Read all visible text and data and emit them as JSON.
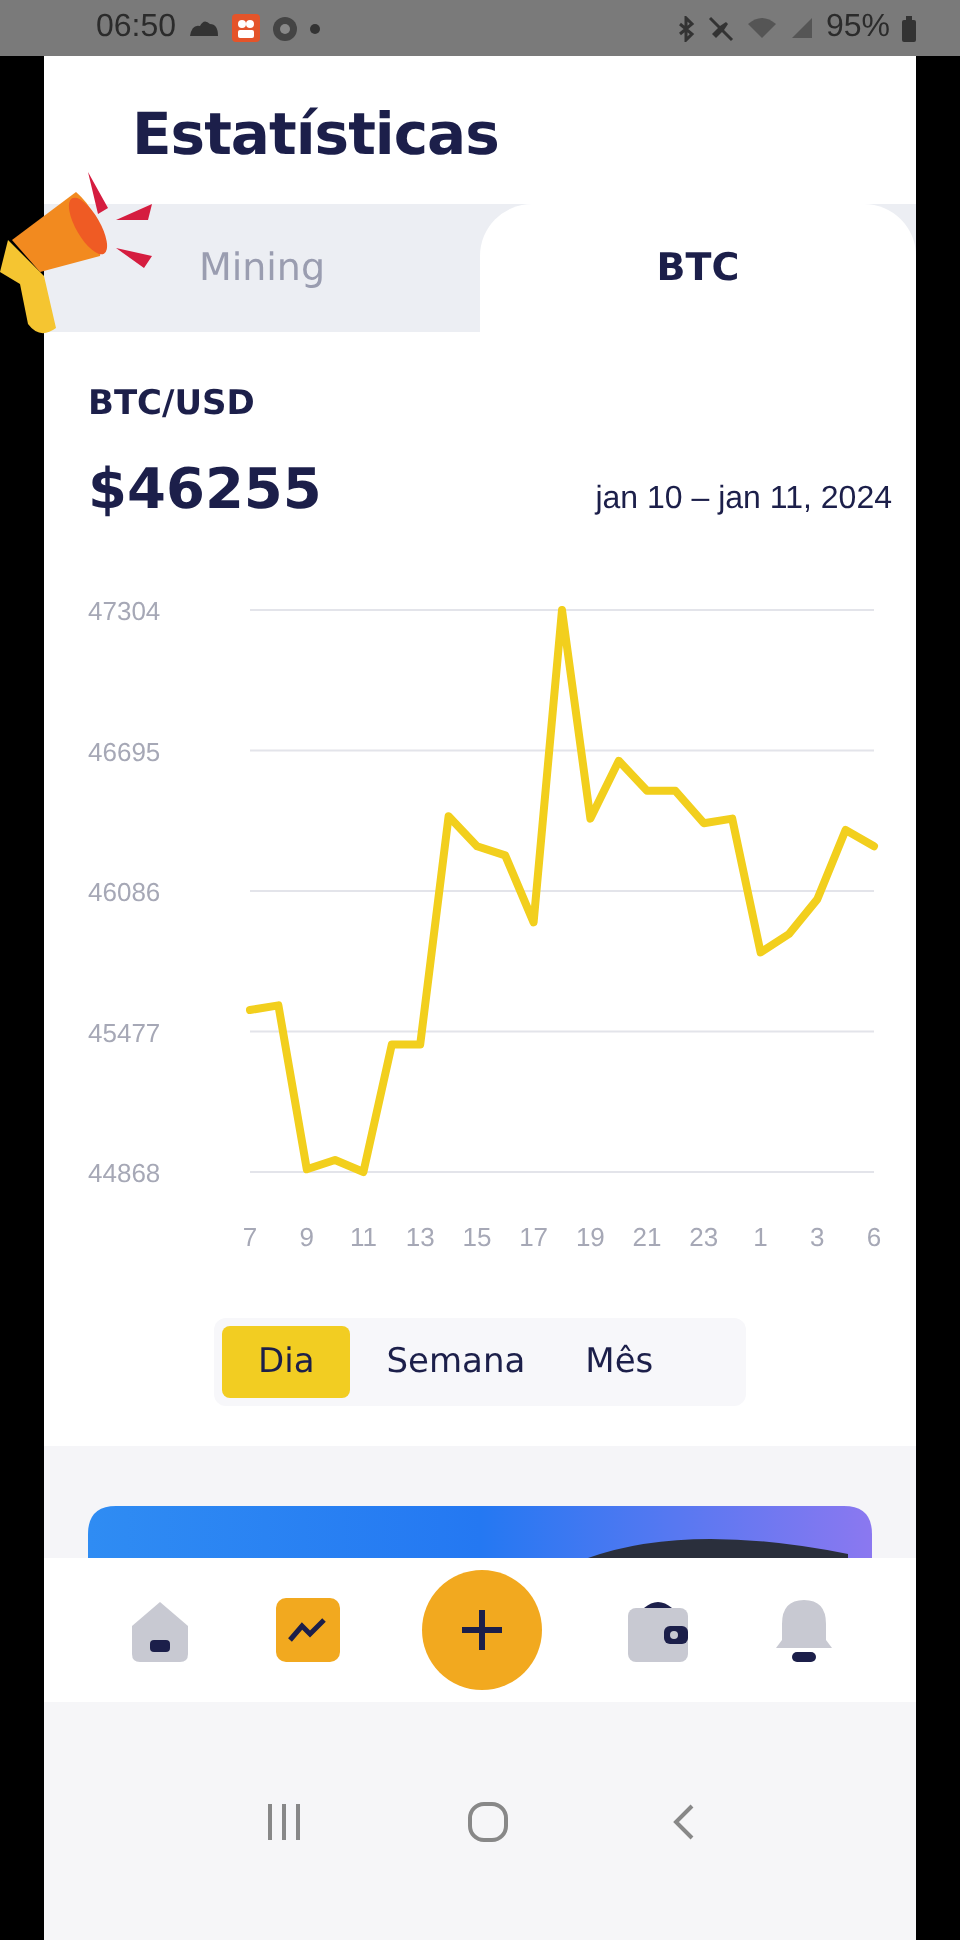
{
  "status_bar": {
    "time": "06:50",
    "battery": "95%"
  },
  "title": "Estatísticas",
  "tabs": [
    {
      "label": "Mining",
      "selected": false
    },
    {
      "label": "BTC",
      "selected": true
    }
  ],
  "pair": "BTC/USD",
  "price": "$46255",
  "date_range": "jan 10 – jan 11, 2024",
  "chart_data": {
    "type": "line",
    "categories": [
      "7",
      null,
      "9",
      null,
      "11",
      null,
      "13",
      null,
      "15",
      null,
      "17",
      null,
      "19",
      null,
      "21",
      null,
      "23",
      null,
      "1",
      null,
      "3",
      null,
      "6"
    ],
    "grid": true,
    "ylim": [
      44868,
      47304
    ],
    "yticks": [
      44868,
      45477,
      46086,
      46695,
      47304
    ],
    "series": [
      {
        "color": "#f2cf1d",
        "values": [
          45570,
          45590,
          44880,
          44920,
          44868,
          45420,
          45420,
          46410,
          46280,
          46240,
          45950,
          47304,
          46400,
          46650,
          46520,
          46520,
          46380,
          46400,
          45820,
          45900,
          46050,
          46350,
          46280
        ]
      }
    ]
  },
  "periods": [
    {
      "label": "Dia",
      "selected": true
    },
    {
      "label": "Semana",
      "selected": false
    },
    {
      "label": "Mês",
      "selected": false
    }
  ],
  "nav": [
    {
      "kind": "home",
      "selected": false
    },
    {
      "kind": "chart",
      "selected": true
    },
    {
      "kind": "add",
      "selected": false
    },
    {
      "kind": "wallet",
      "selected": false
    },
    {
      "kind": "bell",
      "selected": false
    }
  ]
}
